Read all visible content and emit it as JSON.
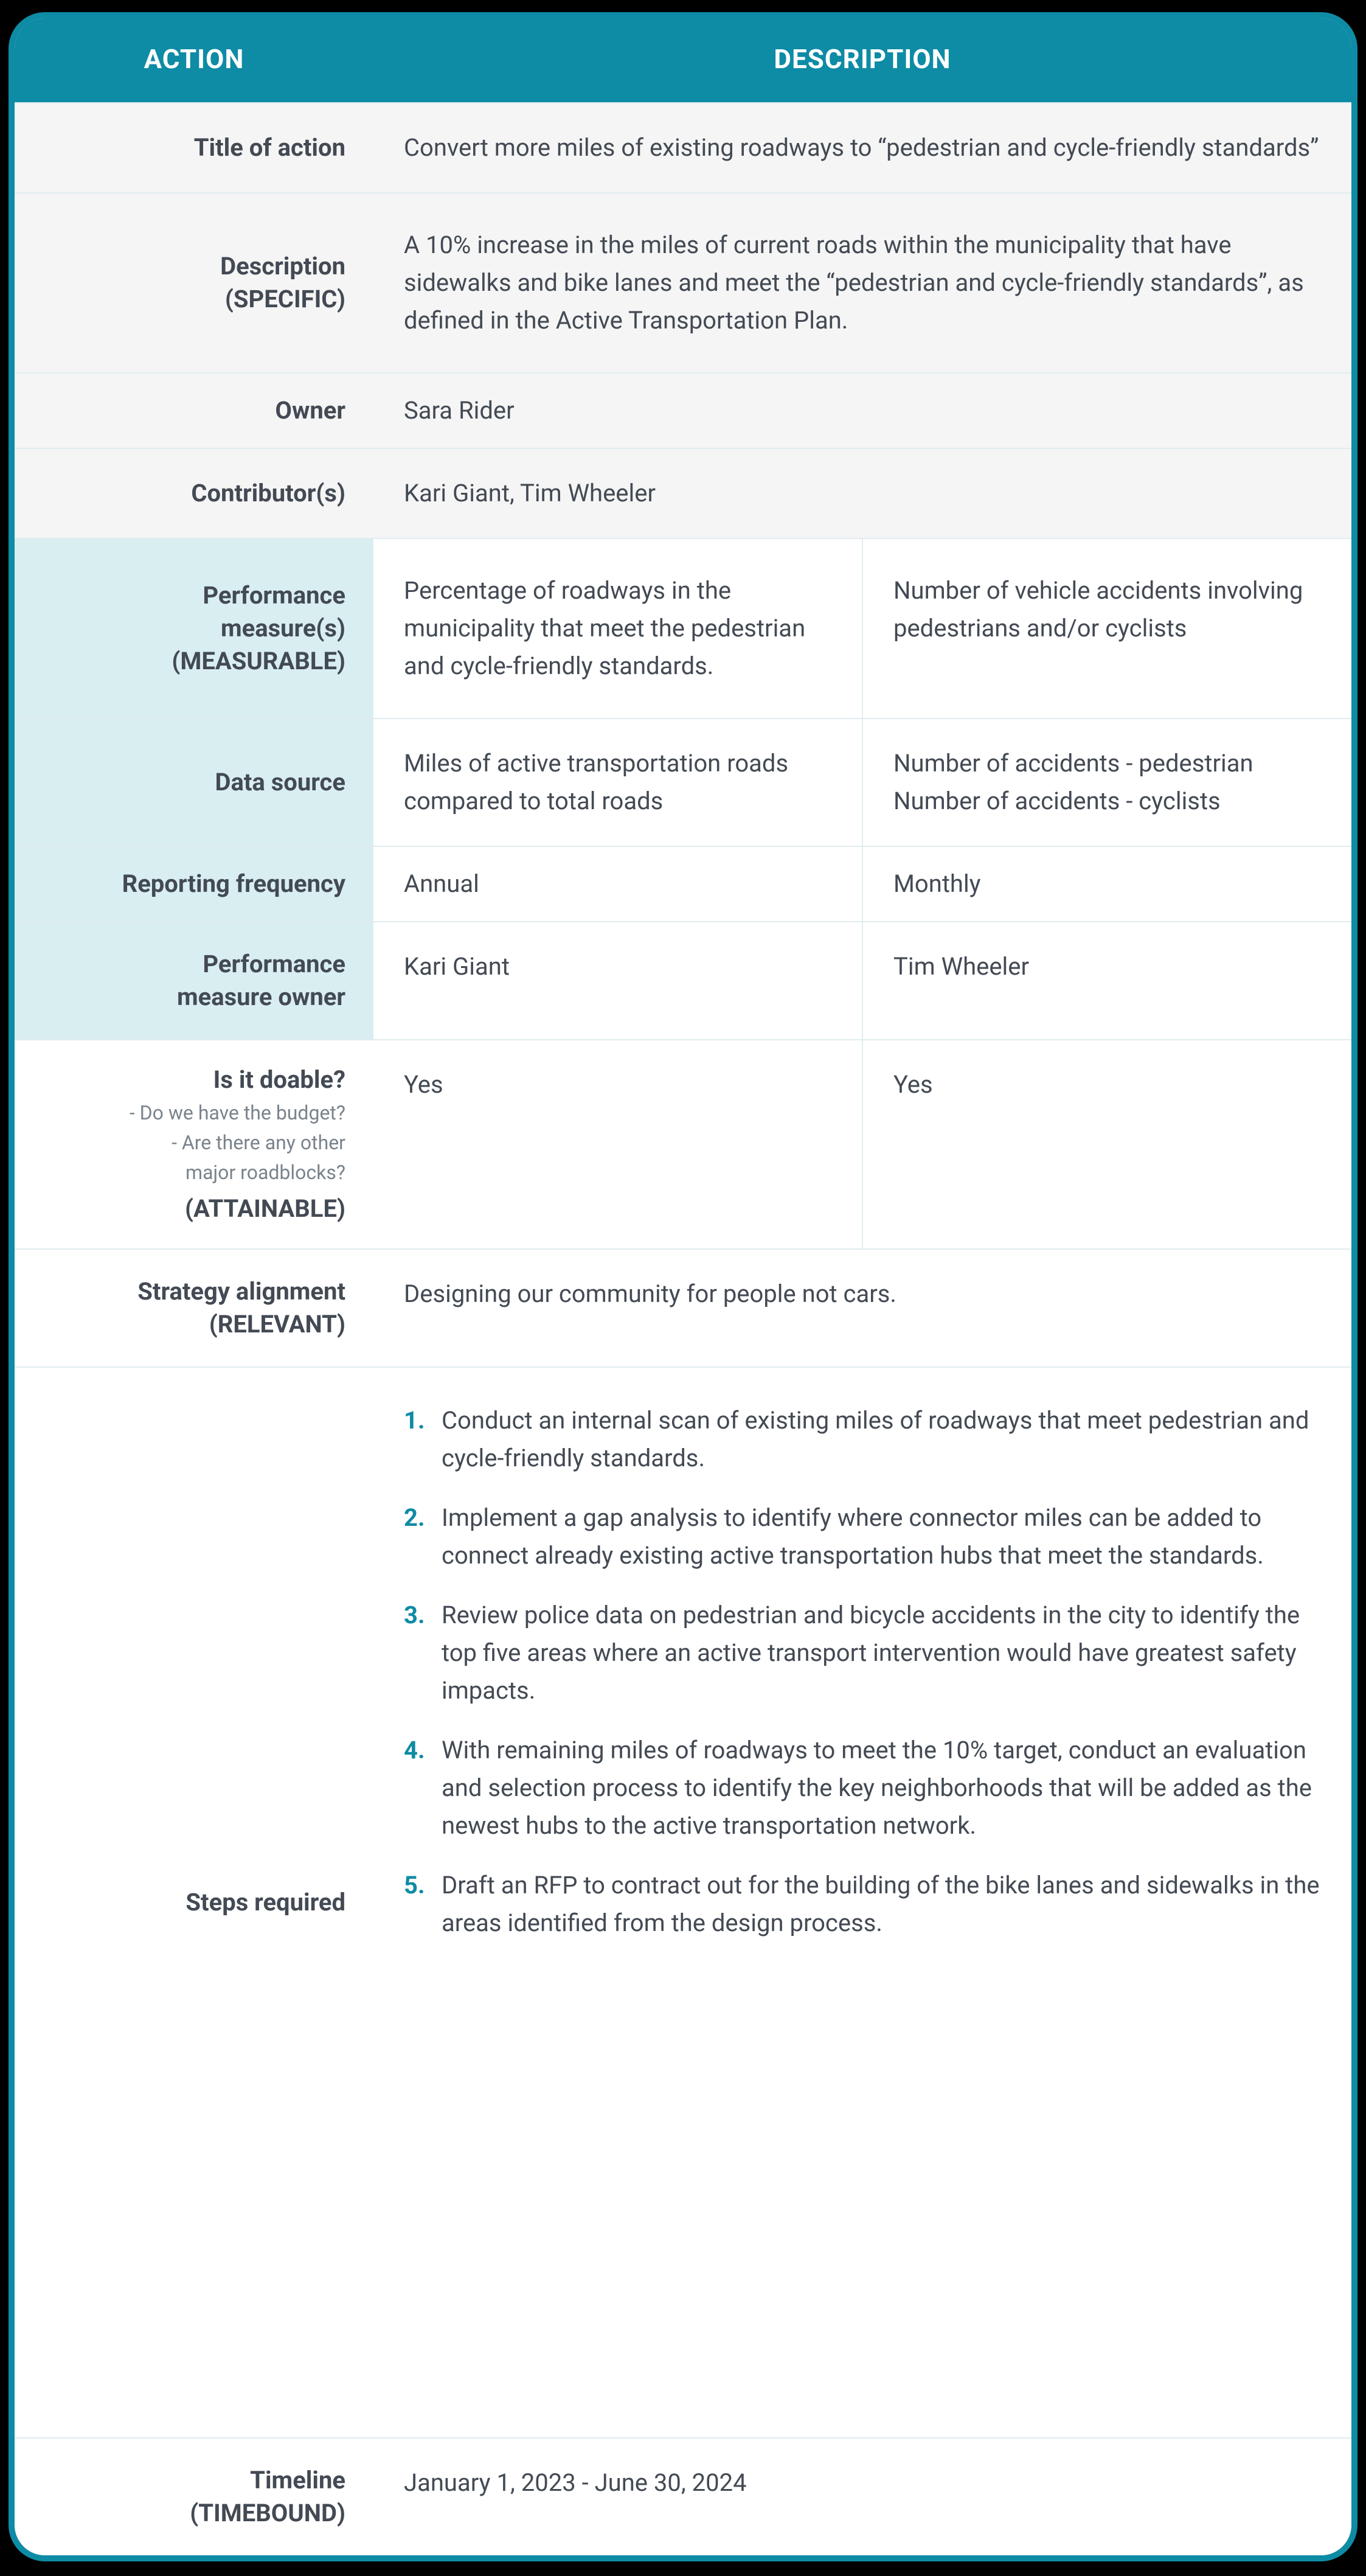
{
  "header": {
    "action": "ACTION",
    "description": "DESCRIPTION"
  },
  "rows": {
    "title_of_action": {
      "label": "Title of action",
      "value": "Convert more miles of existing roadways to “pedestrian and cycle-friendly standards”"
    },
    "description_specific": {
      "label_line1": "Description",
      "label_line2": "(SPECIFIC)",
      "value": "A 10% increase in the miles of current roads within the municipality that have sidewalks and bike lanes and meet the “pedestrian and cycle-friendly standards”, as defined in the Active Transportation Plan."
    },
    "owner": {
      "label": "Owner",
      "value": "Sara Rider"
    },
    "contributors": {
      "label": "Contributor(s)",
      "value": "Kari Giant, Tim Wheeler"
    },
    "perf_measures": {
      "label_line1": "Performance",
      "label_line2": "measure(s)",
      "label_line3": "(MEASURABLE)",
      "col1": "Percentage of roadways in the municipality that meet the pedestrian and cycle-friendly standards.",
      "col2": "Number of vehicle accidents involving pedestrians and/or cyclists"
    },
    "data_source": {
      "label": "Data source",
      "col1": "Miles of active transportation roads compared to total roads",
      "col2_line1": "Number of accidents - pedestrian",
      "col2_line2": "Number of accidents - cyclists"
    },
    "reporting_freq": {
      "label": "Reporting frequency",
      "col1": "Annual",
      "col2": "Monthly"
    },
    "perf_owner": {
      "label_line1": "Performance",
      "label_line2": "measure owner",
      "col1": "Kari Giant",
      "col2": "Tim Wheeler"
    },
    "is_doable": {
      "label_main": "Is it doable?",
      "label_sub1": "- Do we have the budget?",
      "label_sub2": "- Are there any other",
      "label_sub3": "major roadblocks?",
      "label_tag": "(ATTAINABLE)",
      "col1": "Yes",
      "col2": "Yes"
    },
    "strategy_alignment": {
      "label_line1": "Strategy alignment",
      "label_line2": "(RELEVANT)",
      "value": "Designing our community for people not cars."
    },
    "steps_required": {
      "label": "Steps required",
      "items": [
        "Conduct an internal scan of existing miles of roadways that meet pedestrian and cycle-friendly standards.",
        " Implement a gap analysis to identify where connector miles can be added to connect already existing active transportation hubs that meet the standards.",
        " Review police data on pedestrian and bicycle accidents in the city to identify the top five areas where an active transport intervention would have greatest safety impacts.",
        " With remaining miles of roadways to meet the 10% target, conduct an evaluation and selection process to identify the key neighborhoods that will be added as the newest hubs to the active transportation network.",
        " Draft an RFP to contract out for the building of the bike lanes and sidewalks in the areas identified from the design process."
      ]
    },
    "timeline": {
      "label_line1": "Timeline",
      "label_line2": "(TIMEBOUND)",
      "value": "January 1, 2023  -  June 30, 2024"
    }
  }
}
